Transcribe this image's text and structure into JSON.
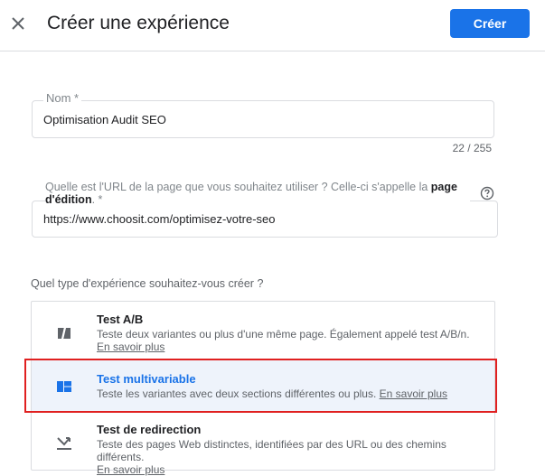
{
  "header": {
    "close_icon": "close-icon",
    "title": "Créer une expérience",
    "create_label": "Créer",
    "accent_color": "#1a73e8"
  },
  "form": {
    "name": {
      "label": "Nom *",
      "value": "Optimisation Audit SEO",
      "counter": "22 / 255"
    },
    "url": {
      "label_part1": "Quelle est l'URL de la page que vous souhaitez utiliser ? Celle-ci s'appelle la ",
      "label_bold": "page d'édition",
      "label_part2": ". *",
      "value": "https://www.choosit.com/optimisez-votre-seo",
      "help_icon": "help-circle-icon"
    },
    "question": "Quel type d'expérience souhaitez-vous créer ?"
  },
  "options": [
    {
      "title": "Test A/B",
      "description": "Teste deux variantes ou plus d'une même page. Également appelé test A/B/n.",
      "link": "En savoir plus",
      "icon": "ab-test-icon",
      "selected": false
    },
    {
      "title": "Test multivariable",
      "description": "Teste les variantes avec deux sections différentes ou plus.",
      "link": "En savoir plus",
      "icon": "multivariate-icon",
      "selected": true
    },
    {
      "title": "Test de redirection",
      "description": "Teste des pages Web distinctes, identifiées par des URL ou des chemins différents.",
      "link": "En savoir plus",
      "icon": "redirect-icon",
      "selected": false
    }
  ],
  "highlight_color": "#e02020"
}
